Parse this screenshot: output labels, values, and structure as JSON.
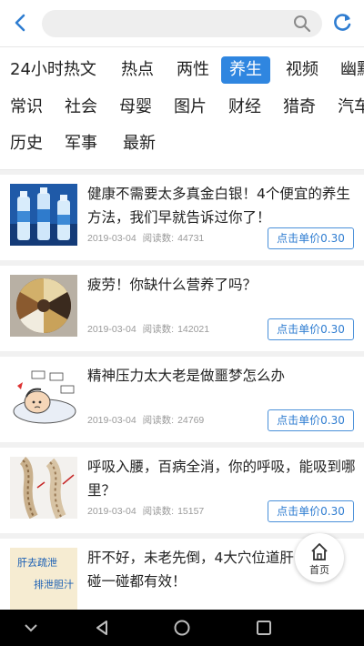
{
  "search": {
    "placeholder": ""
  },
  "categories": [
    {
      "label": "24小时热文",
      "active": false
    },
    {
      "label": "热点",
      "active": false
    },
    {
      "label": "两性",
      "active": false
    },
    {
      "label": "养生",
      "active": true
    },
    {
      "label": "视频",
      "active": false
    },
    {
      "label": "幽默",
      "active": false
    },
    {
      "label": "常识",
      "active": false
    },
    {
      "label": "社会",
      "active": false
    },
    {
      "label": "母婴",
      "active": false
    },
    {
      "label": "图片",
      "active": false
    },
    {
      "label": "财经",
      "active": false
    },
    {
      "label": "猎奇",
      "active": false
    },
    {
      "label": "汽车",
      "active": false
    },
    {
      "label": "历史",
      "active": false
    },
    {
      "label": "军事",
      "active": false
    },
    {
      "label": "最新",
      "active": false
    }
  ],
  "articles": [
    {
      "title": "健康不需要太多真金白银！4个便宜的养生方法，我们早就告诉过你了！",
      "date": "2019-03-04",
      "reads_label": "阅读数:",
      "reads": "44731",
      "price": "点击单价0.30"
    },
    {
      "title": "疲劳！你缺什么营养了吗？",
      "date": "2019-03-04",
      "reads_label": "阅读数:",
      "reads": "142021",
      "price": "点击单价0.30"
    },
    {
      "title": "精神压力太大老是做噩梦怎么办",
      "date": "2019-03-04",
      "reads_label": "阅读数:",
      "reads": "24769",
      "price": "点击单价0.30"
    },
    {
      "title": "呼吸入腰，百病全消，你的呼吸，能吸到哪里？",
      "date": "2019-03-04",
      "reads_label": "阅读数:",
      "reads": "15157",
      "price": "点击单价0.30"
    },
    {
      "title": "肝不好，未老先倒，4大穴位道肝，碰一碰都有效！",
      "date": "",
      "reads_label": "",
      "reads": "",
      "price": "",
      "thumb_text_1": "肝去疏泄",
      "thumb_text_2": "排泄胆汁"
    }
  ],
  "home": {
    "label": "首页"
  },
  "colors": {
    "accent": "#2f86e0",
    "price_border": "#4a90d9"
  }
}
